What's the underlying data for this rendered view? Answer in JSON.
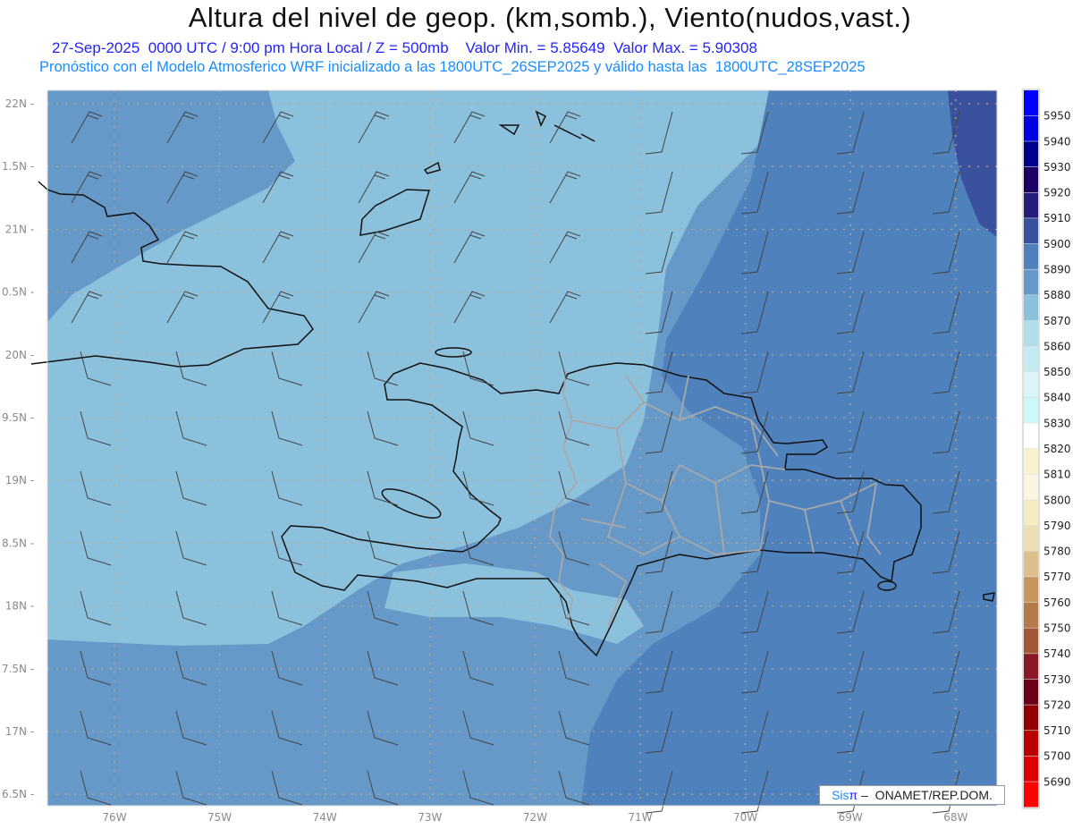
{
  "header": {
    "title": "Altura del nivel de geop. (km,somb.), Viento(nudos,vast.)",
    "subtitle": "27-Sep-2025  0000 UTC / 9:00 pm Hora Local / Z = 500mb    Valor Min. = 5.85649  Valor Max. = 5.90308",
    "model_line": "Pronóstico con el Modelo Atmosferico WRF inicializado a las 1800UTC_26SEP2025 y válido hasta las  1800UTC_28SEP2025"
  },
  "axes": {
    "lon_labels": [
      "76W",
      "75W",
      "74W",
      "73W",
      "72W",
      "71W",
      "70W",
      "69W",
      "68W"
    ],
    "lat_labels": [
      "22N",
      "1.5N",
      "21N",
      "0.5N",
      "20N",
      "9.5N",
      "19N",
      "8.5N",
      "18N",
      "7.5N",
      "17N",
      "6.5N"
    ]
  },
  "colorbar": {
    "levels": [
      "5950",
      "5940",
      "5930",
      "5920",
      "5910",
      "5900",
      "5890",
      "5880",
      "5870",
      "5860",
      "5850",
      "5840",
      "5830",
      "5820",
      "5810",
      "5800",
      "5790",
      "5780",
      "5770",
      "5760",
      "5750",
      "5740",
      "5730",
      "5720",
      "5710",
      "5700",
      "5690"
    ],
    "colors": [
      "#0000ff",
      "#0000e0",
      "#00008b",
      "#1a0062",
      "#261c7c",
      "#3a519e",
      "#4f82bd",
      "#6699c8",
      "#8cc1dd",
      "#b0deea",
      "#c4ebf2",
      "#dcf4f7",
      "#ccf8fa",
      "#ffffff",
      "#f8f2d0",
      "#faf5e3",
      "#f5ebc5",
      "#eddfb5",
      "#dcc08c",
      "#c8965c",
      "#b57a4a",
      "#a05838",
      "#8a1a28",
      "#6a0018",
      "#900000",
      "#b80000",
      "#dc0000",
      "#ff0000"
    ]
  },
  "map_colors": {
    "light": "#8cc1dd",
    "mid": "#6699c8",
    "dark": "#4f82bd",
    "darker": "#3a519e",
    "coast": "#111111",
    "borders": "#a8a8a8",
    "grid": "#c0a888"
  },
  "logo": {
    "sis": "Sis",
    "pi": "π",
    "rest": " –  ONAMET/REP.DOM."
  }
}
